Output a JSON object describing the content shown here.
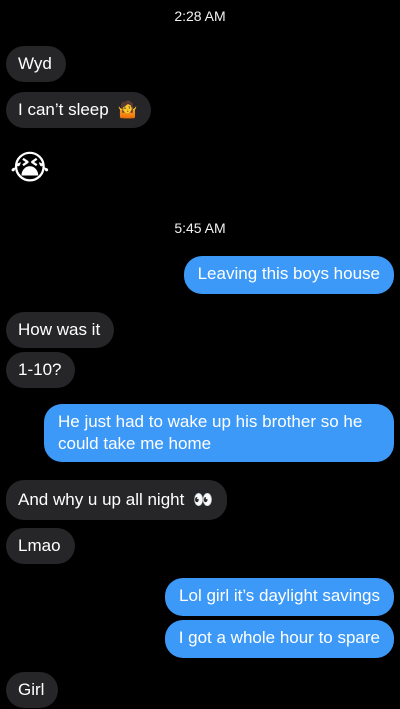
{
  "conversation": {
    "timestamp_1": "2:28 AM",
    "timestamp_2": "5:45 AM",
    "messages": [
      {
        "text": "Wyd"
      },
      {
        "text": "I can’t sleep",
        "emoji": "🤷"
      },
      {
        "emoji": "😭"
      },
      {
        "text": "Leaving this boys house"
      },
      {
        "text": "How was it"
      },
      {
        "text": "1-10?"
      },
      {
        "text": "He just had to wake up his brother so he could take me home"
      },
      {
        "text": "And why u up all night",
        "emoji": "👀"
      },
      {
        "text": "Lmao"
      },
      {
        "text": "Lol girl it’s daylight savings"
      },
      {
        "text": "I got a whole hour to spare"
      },
      {
        "text": "Girl"
      }
    ]
  },
  "colors": {
    "incoming_bubble": "#262628",
    "outgoing_bubble": "#3c99f7",
    "background": "#000000"
  }
}
